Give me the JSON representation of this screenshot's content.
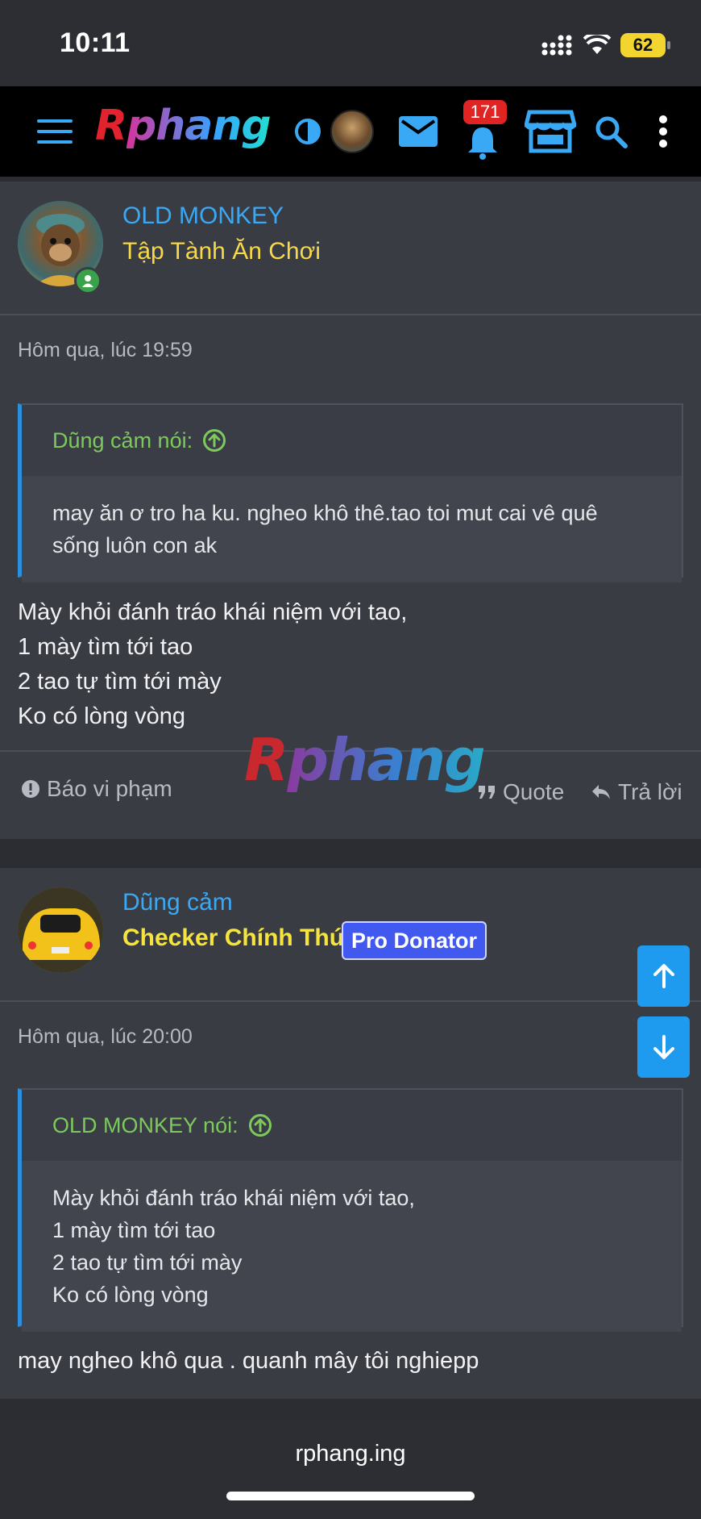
{
  "status_bar": {
    "time": "10:11",
    "battery": "62"
  },
  "header": {
    "logo_r": "R",
    "logo_rest": "phang",
    "notification_count": "171",
    "icons": [
      "menu-icon",
      "theme-toggle-icon",
      "avatar",
      "mail-icon",
      "bell-icon",
      "store-icon",
      "search-icon",
      "more-vertical-icon"
    ]
  },
  "posts": [
    {
      "username": "OLD MONKEY",
      "user_title": "Tập Tành Ăn Chơi",
      "time": "Hôm qua, lúc 19:59",
      "quote": {
        "author": "Dũng cảm nói:",
        "lines": [
          "may ăn ơ tro ha ku. ngheo khô thê.tao toi mut cai vê quê",
          "sống luôn con ak"
        ]
      },
      "message_lines": [
        "Mày khỏi đánh tráo khái niệm với tao,",
        "1 mày tìm tới tao",
        "2 tao tự tìm tới mày",
        "Ko có lòng vòng"
      ],
      "actions": {
        "report": "Báo vi phạm",
        "quote": "Quote",
        "reply": "Trả lời"
      }
    },
    {
      "username": "Dũng cảm",
      "user_title": "Checker Chính Thức",
      "badge": "Pro Donator",
      "time": "Hôm qua, lúc 20:00",
      "quote": {
        "author": "OLD MONKEY nói:",
        "lines": [
          "Mày khỏi đánh tráo khái niệm với tao,",
          "1 mày tìm tới tao",
          "2 tao tự tìm tới mày",
          "Ko có lòng vòng"
        ]
      },
      "message_lines": [
        "may ngheo khô qua . quanh mây tôi nghiepp"
      ]
    }
  ],
  "watermark": {
    "r": "R",
    "rest": "phang"
  },
  "browser": {
    "url": "rphang.ing"
  },
  "colors": {
    "accent": "#3aa9f5",
    "title_yellow": "#f6d84a",
    "quote_green": "#7dc95e",
    "badge_blue": "#4259f0",
    "bg": "#3a3c44"
  }
}
